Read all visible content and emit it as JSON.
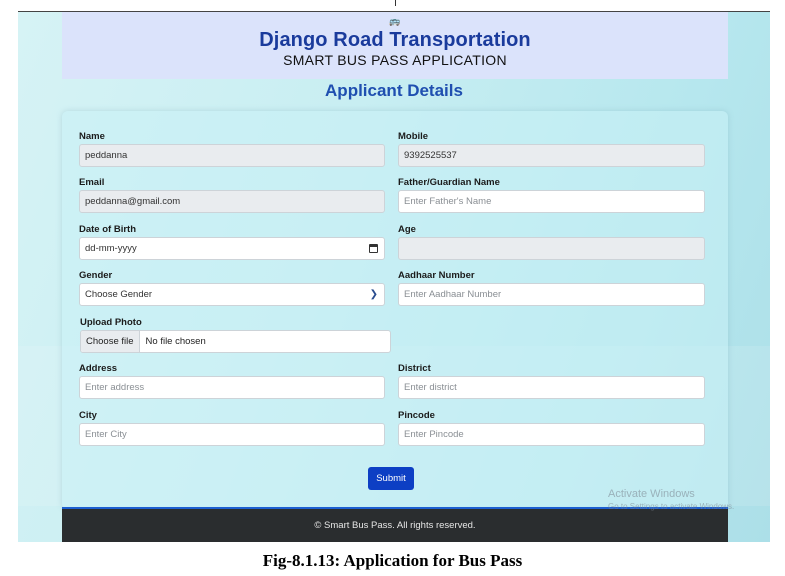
{
  "header": {
    "title": "Django Road Transportation",
    "subtitle": "SMART BUS PASS APPLICATION"
  },
  "section_title": "Applicant Details",
  "form": {
    "name": {
      "label": "Name",
      "value": "peddanna"
    },
    "mobile": {
      "label": "Mobile",
      "value": "9392525537"
    },
    "email": {
      "label": "Email",
      "value": "peddanna@gmail.com"
    },
    "guardian": {
      "label": "Father/Guardian Name",
      "placeholder": "Enter Father's Name"
    },
    "dob": {
      "label": "Date of Birth",
      "value": "dd-mm-yyyy"
    },
    "age": {
      "label": "Age",
      "value": ""
    },
    "gender": {
      "label": "Gender",
      "selected": "Choose Gender"
    },
    "aadhaar": {
      "label": "Aadhaar Number",
      "placeholder": "Enter Aadhaar Number"
    },
    "photo": {
      "label": "Upload Photo",
      "button": "Choose file",
      "status": "No file chosen"
    },
    "address": {
      "label": "Address",
      "placeholder": "Enter address"
    },
    "district": {
      "label": "District",
      "placeholder": "Enter district"
    },
    "city": {
      "label": "City",
      "placeholder": "Enter City"
    },
    "pincode": {
      "label": "Pincode",
      "placeholder": "Enter Pincode"
    },
    "submit": "Submit"
  },
  "footer": "© Smart Bus Pass. All rights reserved.",
  "watermark": {
    "line1": "Activate Windows",
    "line2": "Go to Settings to activate Windows."
  },
  "caption": "Fig-8.1.13: Application for Bus Pass",
  "colors": {
    "accent": "#0d3fc4",
    "title": "#1a3b9c",
    "footer": "#2a2d2f"
  },
  "icons": {
    "logo": "bus-icon",
    "calendar": "calendar-icon",
    "dropdown": "chevron-down-icon"
  }
}
